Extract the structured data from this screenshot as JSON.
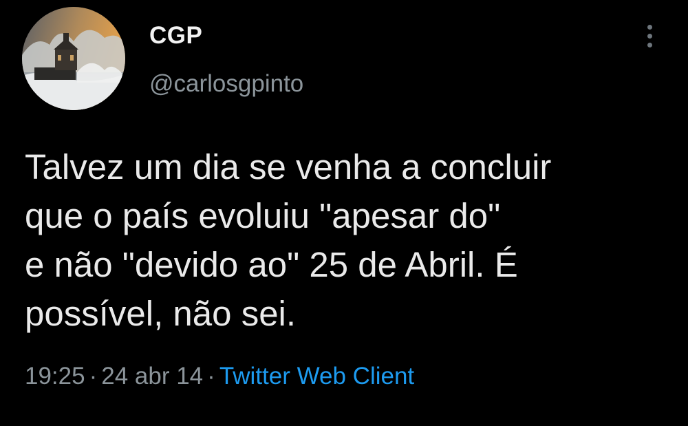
{
  "author": {
    "display_name": "CGP",
    "handle": "@carlosgpinto",
    "avatar_icon": "seaside-chapel-photo-icon"
  },
  "tweet": {
    "text": "Talvez um dia se venha a concluir\nque o país evoluiu \"apesar do\"\ne não \"devido ao\" 25 de Abril. É\npossível, não sei.",
    "time": "19:25",
    "separator": "·",
    "date": "24 abr 14",
    "client": "Twitter Web Client"
  },
  "menu": {
    "icon": "more-vertical-icon"
  },
  "colors": {
    "background": "#000000",
    "text": "#eaeaea",
    "secondary_text": "#8b949a",
    "link": "#1d9bf0"
  }
}
